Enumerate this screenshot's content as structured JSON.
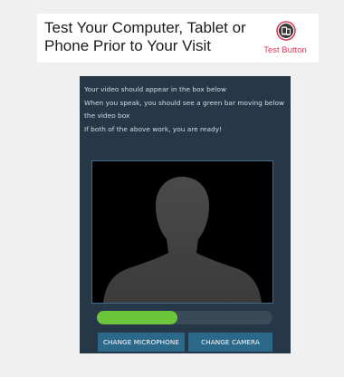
{
  "header": {
    "title_line1": "Test Your Computer, Tablet or",
    "title_line2": "Phone Prior to Your Visit",
    "test_button_label": "Test Button"
  },
  "panel": {
    "instructions": [
      "Your video should appear in the box below",
      "When you speak, you should see a green bar moving below",
      "the video box",
      "If both of the above work, you are ready!"
    ],
    "audio_level_fraction": 0.46,
    "buttons": {
      "change_microphone": "CHANGE MICROPHONE",
      "change_camera": "CHANGE CAMERA"
    }
  },
  "colors": {
    "panel_bg": "#263848",
    "audio_green": "#6dc53b",
    "button_blue": "#2c6889",
    "test_label_red": "#d7405b"
  },
  "icons": {
    "test_button": "phone-tablet-icon",
    "video_placeholder": "person-silhouette-icon"
  }
}
